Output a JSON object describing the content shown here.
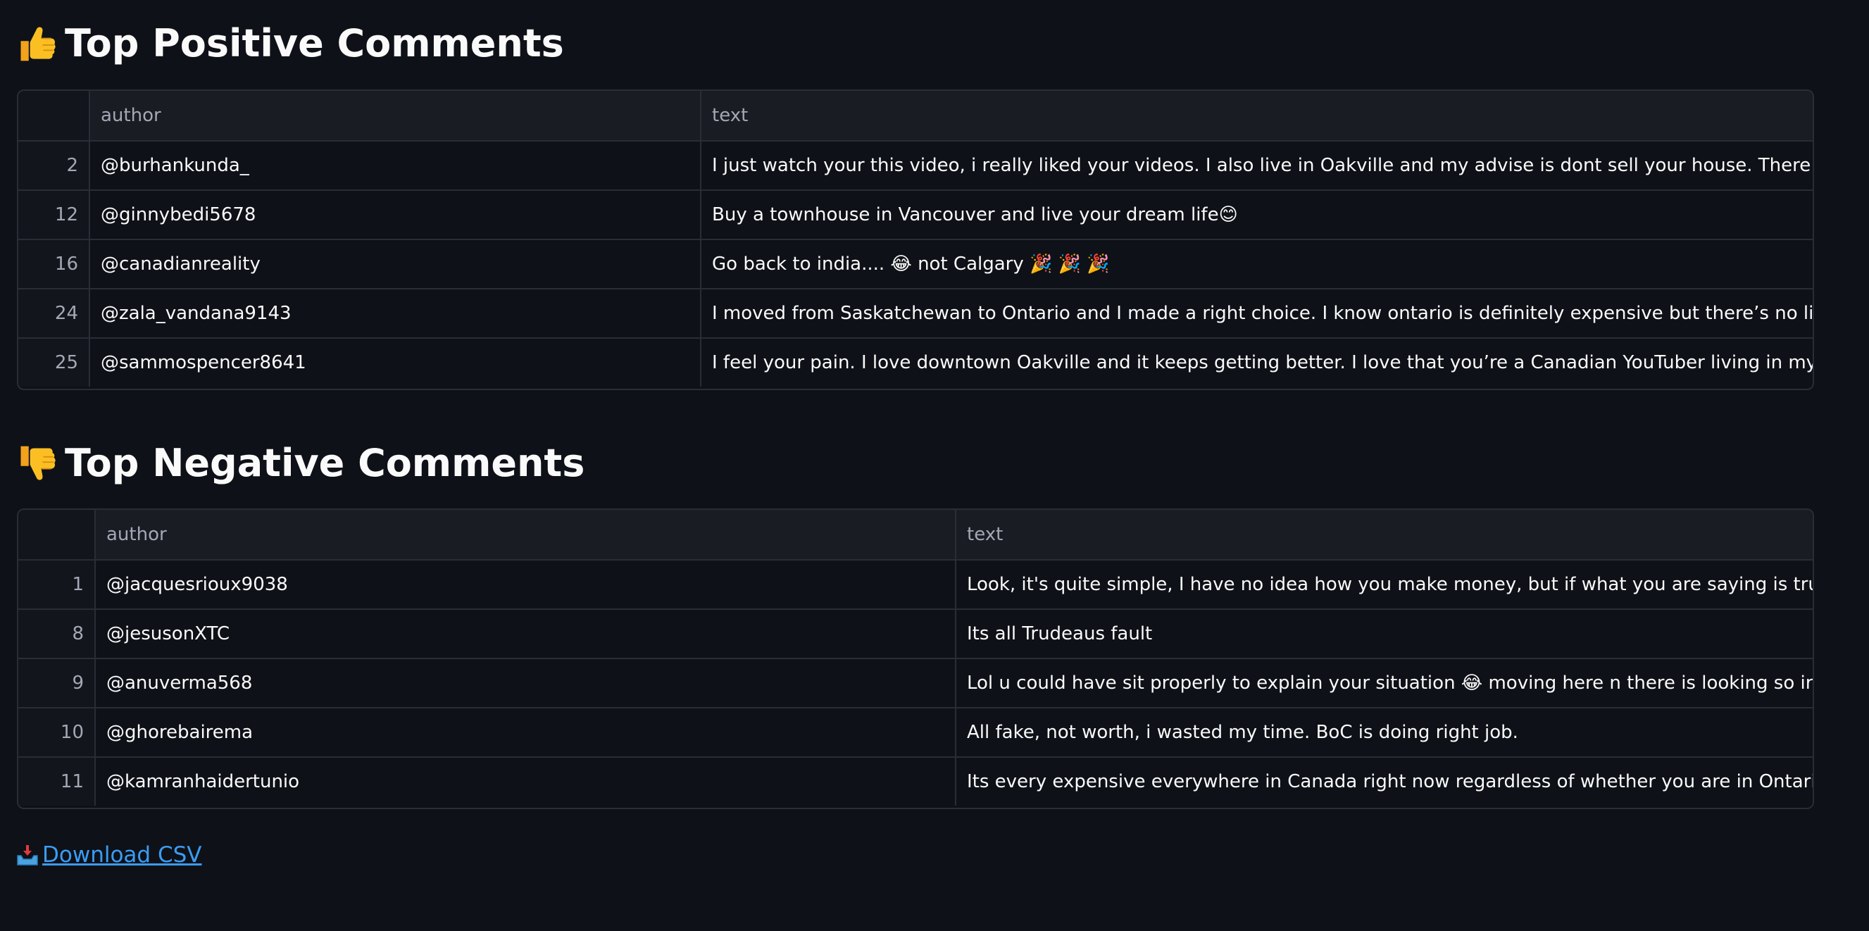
{
  "positive": {
    "title": "Top Positive Comments",
    "icon": "thumbs-up-icon",
    "columns": {
      "author": "author",
      "text": "text"
    },
    "rows": [
      {
        "index": "2",
        "author": "@burhankunda_",
        "text": "I just watch your this video, i really liked your videos. I also live in Oakville and my advise is dont sell your house. There is a big possibili"
      },
      {
        "index": "12",
        "author": "@ginnybedi5678",
        "text": "Buy a townhouse in Vancouver and live your dream life😊"
      },
      {
        "index": "16",
        "author": "@canadianreality",
        "text": "Go back to india.... 😂  not Calgary 🎉 🎉 🎉"
      },
      {
        "index": "24",
        "author": "@zala_vandana9143",
        "text": "I moved from Saskatchewan to Ontario and I made a right choice. I know ontario is definitely expensive but there’s no life that part of th"
      },
      {
        "index": "25",
        "author": "@sammospencer8641",
        "text": "I feel your pain. I love downtown Oakville and it keeps getting better. I love that you’re a Canadian YouTuber living in my neck of the foo"
      }
    ]
  },
  "negative": {
    "title": "Top Negative Comments",
    "icon": "thumbs-down-icon",
    "columns": {
      "author": "author",
      "text": "text"
    },
    "rows": [
      {
        "index": "1",
        "author": "@jacquesrioux9038",
        "text": "Look, it's quite simple, I have no idea how you make money, but if what you are saying is true, you are b"
      },
      {
        "index": "8",
        "author": "@jesusonXTC",
        "text": "Its all Trudeaus fault"
      },
      {
        "index": "9",
        "author": "@anuverma568",
        "text": "Lol u could have sit properly to explain your situation 😂 moving here n there is looking so irritating, wel"
      },
      {
        "index": "10",
        "author": "@ghorebairema",
        "text": "All fake, not worth, i wasted my time. BoC is doing right job."
      },
      {
        "index": "11",
        "author": "@kamranhaidertunio",
        "text": "Its every expensive everywhere in Canada right now regardless of whether you are in Ontario or Alberta."
      }
    ]
  },
  "download": {
    "label": "Download CSV",
    "icon": "inbox-tray-icon"
  },
  "colors": {
    "background": "#0e1117",
    "link": "#3b9cf5",
    "border": "#2a2d36",
    "header_bg": "#1a1c24",
    "muted_text": "#a3a8b4"
  }
}
